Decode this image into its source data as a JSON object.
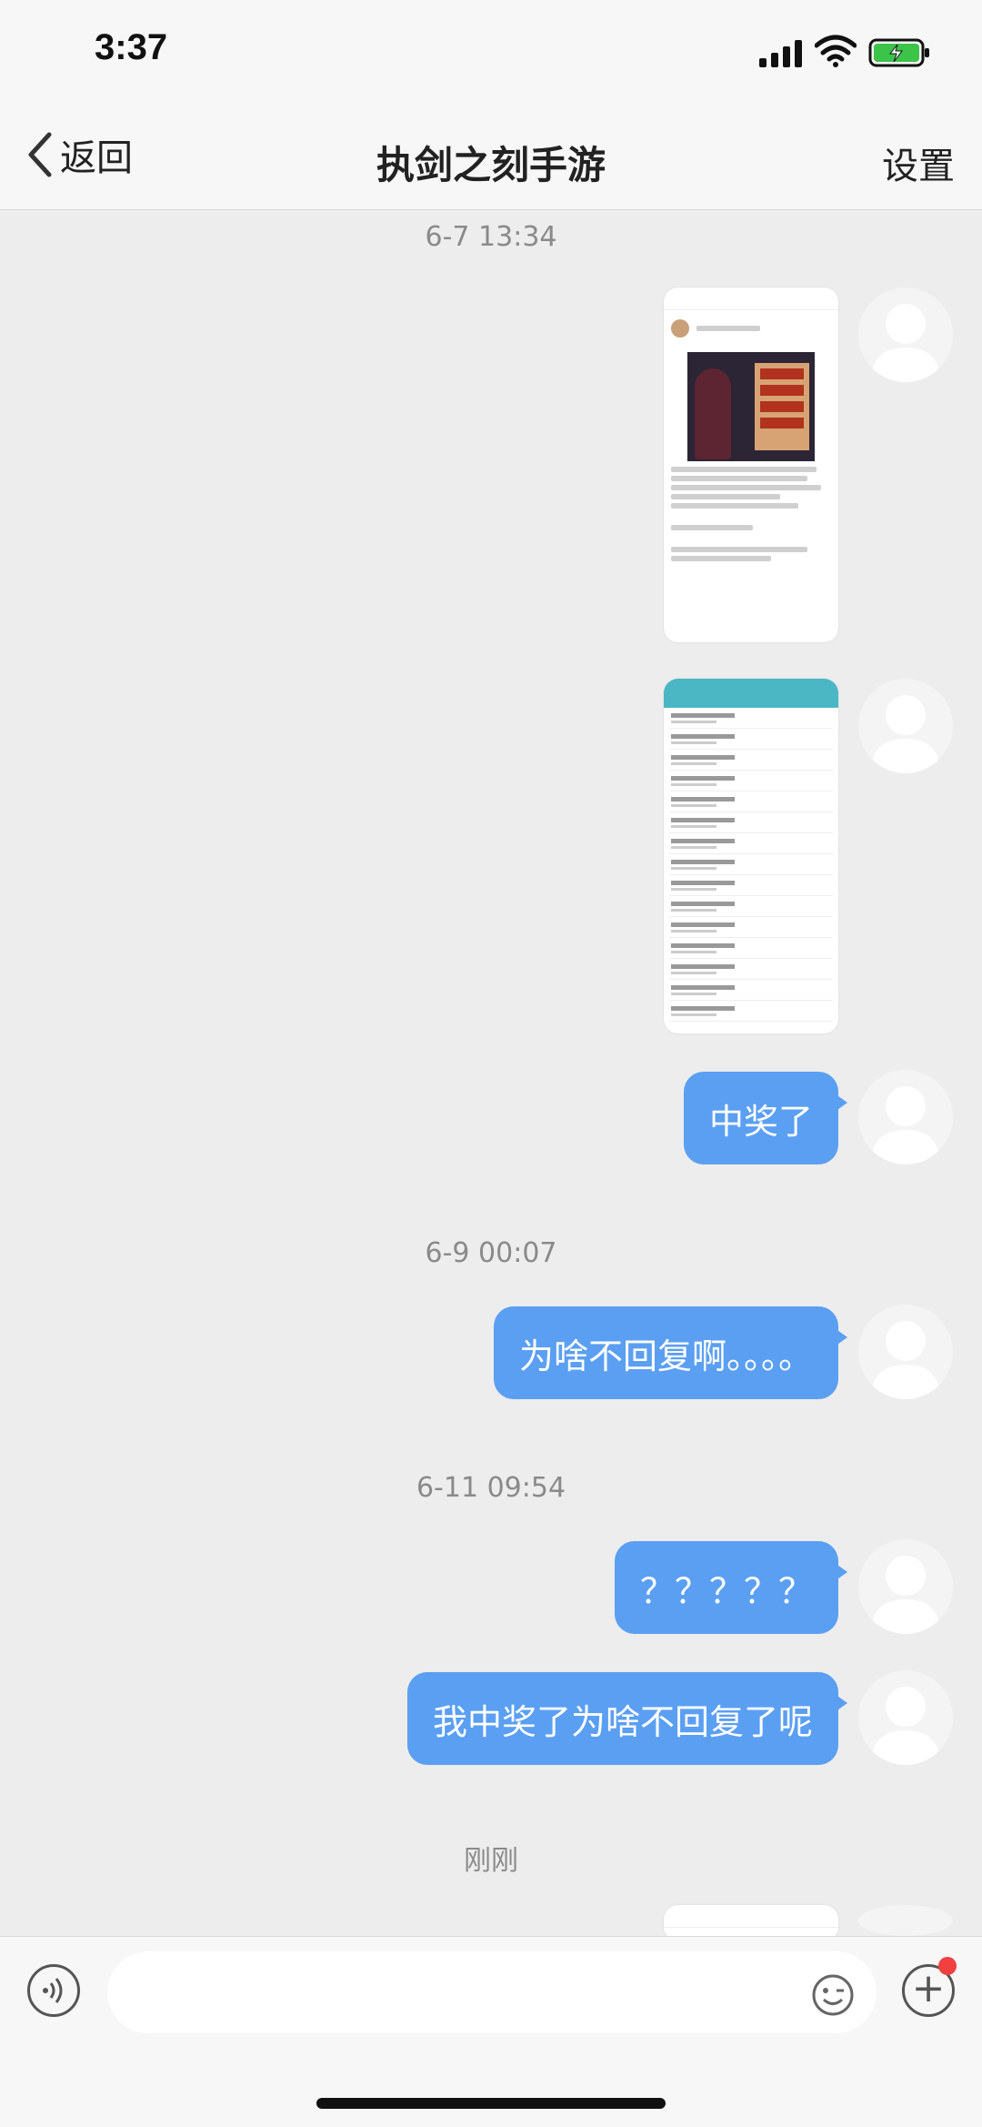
{
  "status_bar": {
    "time": "3:37"
  },
  "nav": {
    "back_label": "返回",
    "title": "执剑之刻手游",
    "settings_label": "设置"
  },
  "chat": {
    "timestamps": [
      "6-7 13:34",
      "6-9 00:07",
      "6-11 09:54",
      "刚刚"
    ],
    "messages": [
      "中奖了",
      "为啥不回复啊。。。。",
      "？？？？？",
      "我中奖了为啥不回复了呢"
    ]
  },
  "colors": {
    "bubble": "#5b9ff2",
    "background": "#ededed",
    "badge": "#f04040"
  },
  "icons": [
    "back-chevron-icon",
    "signal-icon",
    "wifi-icon",
    "battery-charging-icon",
    "voice-icon",
    "emoji-icon",
    "plus-icon",
    "default-avatar-icon"
  ]
}
